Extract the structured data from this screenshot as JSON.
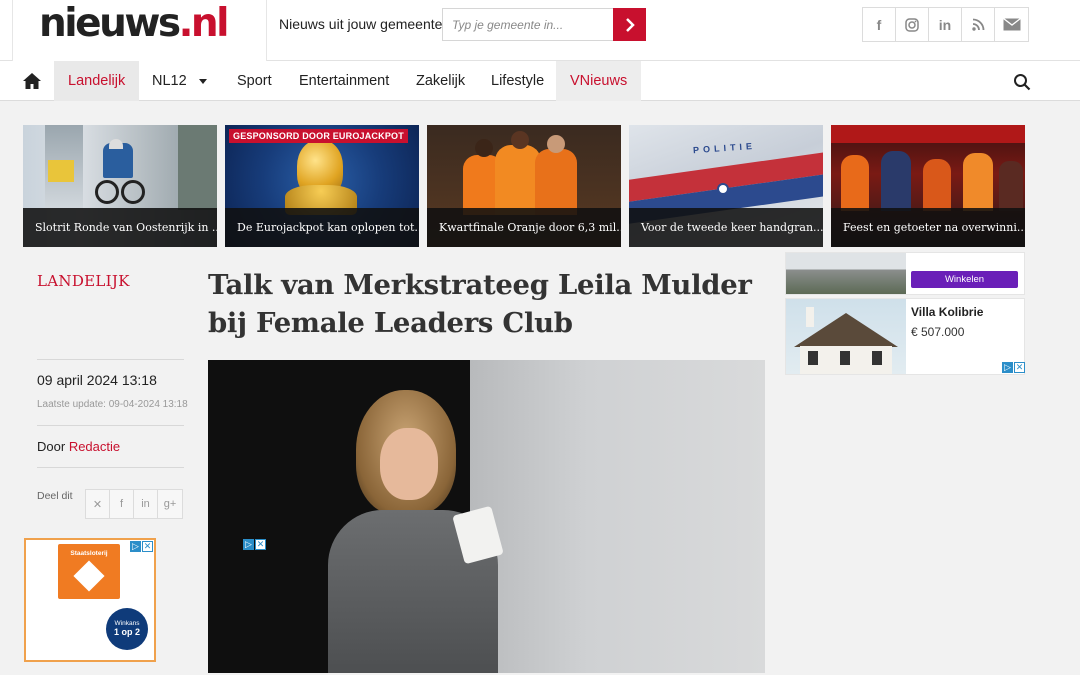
{
  "header": {
    "logo_part1": "nieuws",
    "logo_part2": ".nl",
    "gemeente_label": "Nieuws uit jouw gemeente:",
    "gemeente_placeholder": "Typ je gemeente in...",
    "social_icons": [
      "facebook-icon",
      "instagram-icon",
      "linkedin-icon",
      "rss-icon",
      "mail-icon"
    ]
  },
  "nav": {
    "items": [
      {
        "label": "Landelijk"
      },
      {
        "label": "NL12"
      },
      {
        "label": "Sport"
      },
      {
        "label": "Entertainment"
      },
      {
        "label": "Zakelijk"
      },
      {
        "label": "Lifestyle"
      },
      {
        "label": "VNieuws"
      }
    ],
    "active": "Landelijk"
  },
  "thumbs": [
    {
      "caption": "Slotrit Ronde van Oostenrijk in ..."
    },
    {
      "caption": "De Eurojackpot kan oplopen tot...",
      "badge": "GESPONSORD DOOR EUROJACKPOT"
    },
    {
      "caption": "Kwartfinale Oranje door 6,3 mil..."
    },
    {
      "caption": "Voor de tweede keer handgran..."
    },
    {
      "caption": "Feest en getoeter na overwinni..."
    }
  ],
  "article": {
    "section": "LANDELIJK",
    "title": "Talk van Merkstrateeg Leila Mulder bij Female Leaders Club",
    "date": "09 april 2024 13:18",
    "updated": "Laatste update: 09-04-2024 13:18",
    "author_prefix": "Door",
    "author": "Redactie",
    "share_label": "Deel dit",
    "share_icons": [
      "x-icon",
      "facebook-icon",
      "linkedin-icon",
      "googleplus-icon"
    ]
  },
  "ads": {
    "left_brand": "Staatsloterij",
    "left_badge_line1": "Winkans",
    "left_badge_line2": "1 op 2",
    "right_button": "Winkelen",
    "right_title": "Villa Kolibrie",
    "right_price": "€ 507.000"
  },
  "colors": {
    "brand_red": "#c8102e",
    "ad_purple": "#6a1fb8"
  }
}
